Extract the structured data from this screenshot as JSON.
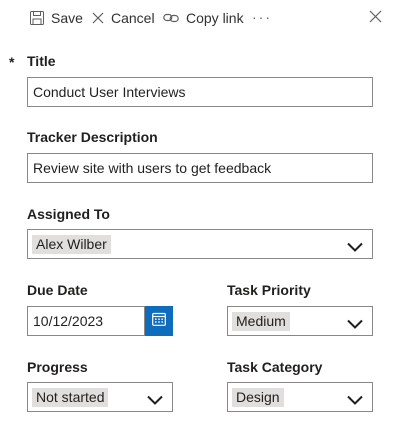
{
  "toolbar": {
    "save_label": "Save",
    "cancel_label": "Cancel",
    "copy_link_label": "Copy link",
    "more_label": "···"
  },
  "form": {
    "required_marker": "*",
    "title": {
      "label": "Title",
      "value": "Conduct User Interviews"
    },
    "tracker_description": {
      "label": "Tracker Description",
      "value": "Review site with users to get feedback"
    },
    "assigned_to": {
      "label": "Assigned To",
      "value": "Alex Wilber"
    },
    "due_date": {
      "label": "Due Date",
      "value": "10/12/2023"
    },
    "task_priority": {
      "label": "Task Priority",
      "value": "Medium"
    },
    "progress": {
      "label": "Progress",
      "value": "Not started"
    },
    "task_category": {
      "label": "Task Category",
      "value": "Design"
    }
  },
  "colors": {
    "accent": "#0f6cbd",
    "field_border": "#8a8886",
    "pill_background": "#e1dfdd",
    "text": "#201f1e"
  },
  "icons": [
    "save-icon",
    "cancel-icon",
    "link-icon",
    "close-icon",
    "calendar-icon",
    "chevron-down-icon"
  ]
}
